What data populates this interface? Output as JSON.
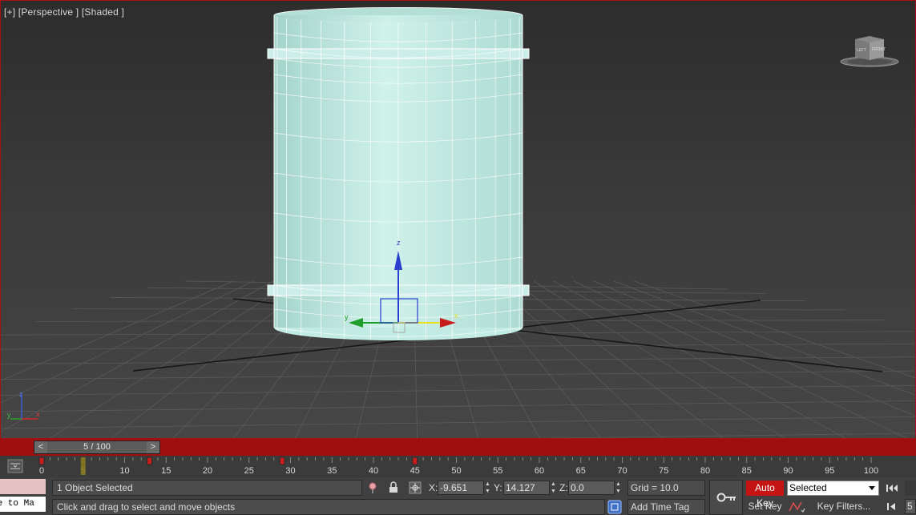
{
  "viewport": {
    "label": "[+] [Perspective ] [Shaded ]",
    "gizmo_axes": {
      "x": "x",
      "y": "y",
      "z": "z"
    },
    "viewcube": {
      "labels": [
        "LEFT",
        "FRONT"
      ]
    },
    "colors": {
      "border": "#a61010",
      "object": "#c2ece3",
      "wire": "#ffffff",
      "grid": "#5a5a5a"
    }
  },
  "timeline": {
    "slider_text": "5 / 100",
    "prev": "<",
    "next": ">",
    "current_frame": 5,
    "total_frames": 100,
    "ruler_labels": [
      "0",
      "5",
      "10",
      "15",
      "20",
      "25",
      "30",
      "35",
      "40",
      "45",
      "50",
      "55",
      "60",
      "65",
      "70",
      "75",
      "80",
      "85",
      "90",
      "95",
      "100"
    ],
    "keyframes": [
      0,
      13,
      29,
      45
    ]
  },
  "status": {
    "maxscript_listener": "me to Ma",
    "selection": "1 Object Selected",
    "prompt": "Click and drag to select and move objects"
  },
  "coords": {
    "x_label": "X:",
    "x_value": "-9.651",
    "y_label": "Y:",
    "y_value": "14.127",
    "z_label": "Z:",
    "z_value": "0.0"
  },
  "grid": {
    "label": "Grid = 10.0"
  },
  "time_tag": {
    "label": "Add Time Tag"
  },
  "animation": {
    "auto_key": "Auto Key",
    "selected": "Selected",
    "set_key": "Set Key",
    "key_filters": "Key Filters...",
    "frame_value": "5"
  }
}
